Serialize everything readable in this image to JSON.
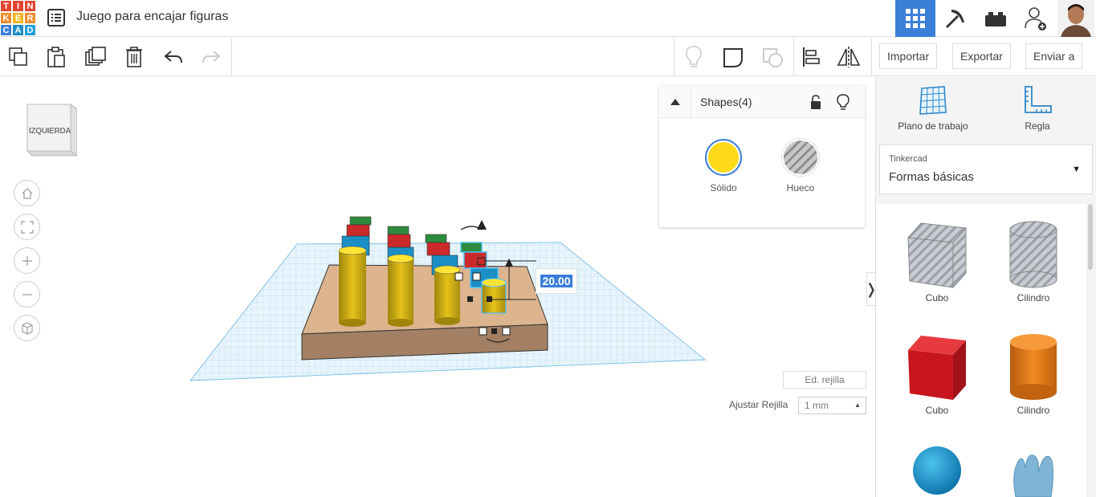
{
  "app": {
    "logo_letters": [
      "T",
      "I",
      "N",
      "K",
      "E",
      "R",
      "C",
      "A",
      "D"
    ],
    "logo_colors": [
      "#e1452e",
      "#e1452e",
      "#e1452e",
      "#ef8c2e",
      "#f5b41e",
      "#ef8c2e",
      "#3b7fd9",
      "#1d8dc6",
      "#1fa0d8"
    ],
    "doc_title": "Juego para encajar figuras"
  },
  "header_tools": [
    "grid-icon",
    "pickaxe-icon",
    "brick-icon",
    "add-user-icon",
    "avatar"
  ],
  "toolbar": {
    "tools": [
      "copy-icon",
      "paste-icon",
      "duplicate-icon",
      "delete-icon",
      "undo-icon",
      "redo-icon"
    ],
    "right_tools": [
      "light-bulb-icon",
      "group-icon",
      "ungroup-icon",
      "align-icon",
      "mirror-icon"
    ],
    "import_label": "Importar",
    "export_label": "Exportar",
    "send_label": "Enviar a"
  },
  "viewport": {
    "viewcube_label": "IZQUIERDA",
    "nav": [
      "home-icon",
      "fit-icon",
      "zoom-in-icon",
      "zoom-out-icon",
      "perspective-icon"
    ],
    "dimension_value": "20.00",
    "edit_grid_label": "Ed. rejilla",
    "snap_label": "Ajustar Rejilla",
    "snap_value": "1 mm"
  },
  "shapes_panel": {
    "title": "Shapes(4)",
    "solid_label": "Sólido",
    "hole_label": "Hueco",
    "solid_color": "#ffd91a"
  },
  "right_panel": {
    "workplane_label": "Plano de trabajo",
    "ruler_label": "Regla",
    "library_small": "Tinkercad",
    "library_name": "Formas básicas",
    "shapes": [
      {
        "label": "Cubo",
        "style": "hole"
      },
      {
        "label": "Cilindro",
        "style": "hole"
      },
      {
        "label": "Cubo",
        "color": "#d8222b"
      },
      {
        "label": "Cilindro",
        "color": "#e8781a"
      },
      {
        "label": "",
        "color": "#1aa3d8"
      },
      {
        "label": "",
        "color": "#7fb4d6"
      }
    ]
  },
  "colors": {
    "accent": "#3b7fd9",
    "workplane": "#bfe3f5",
    "base_block": "#d9b08c"
  }
}
